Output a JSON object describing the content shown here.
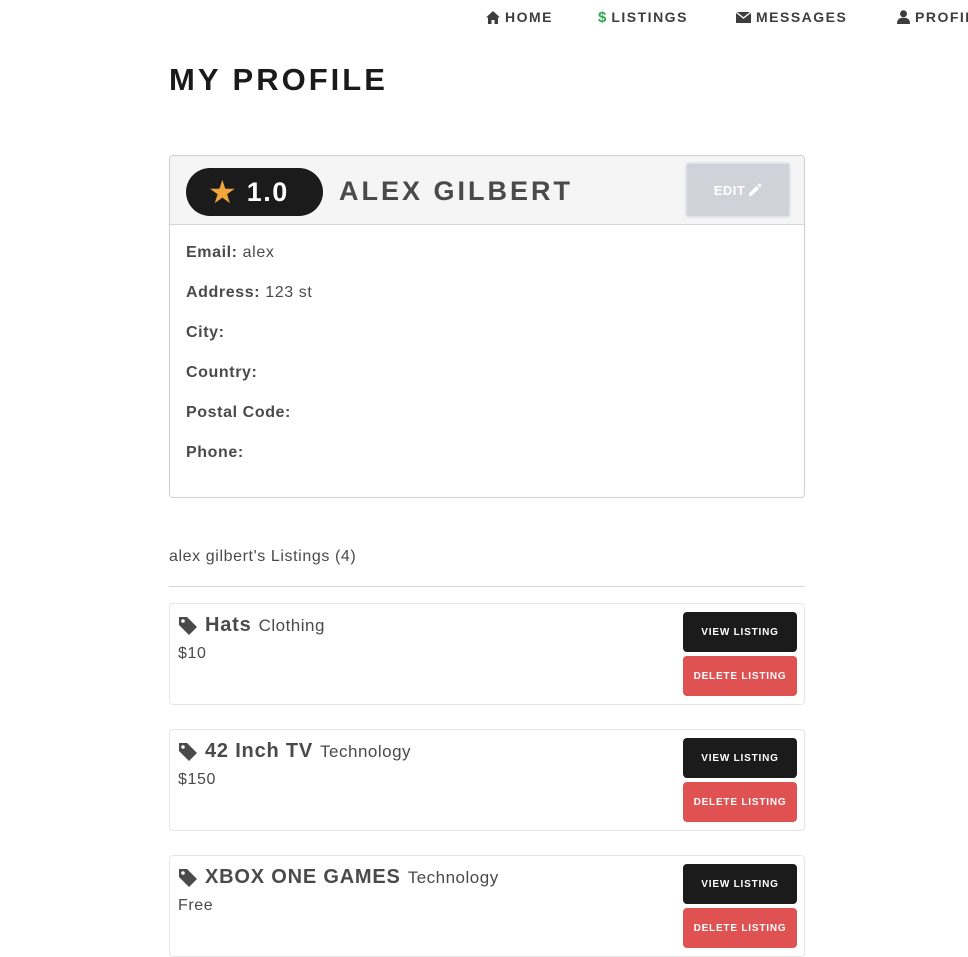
{
  "nav": {
    "items": [
      {
        "label": "HOME",
        "icon": "home-icon"
      },
      {
        "label": "LISTINGS",
        "icon": "dollar-icon"
      },
      {
        "label": "MESSAGES",
        "icon": "envelope-icon"
      },
      {
        "label": "PROFILE",
        "icon": "user-icon"
      }
    ],
    "listings_icon_glyph": "$",
    "listings_icon_color": "#2fa84f"
  },
  "page": {
    "title": "MY PROFILE"
  },
  "profile": {
    "rating": "1.0",
    "rating_icon": "star-icon",
    "star_color": "#f0a63a",
    "name": "ALEX GILBERT",
    "edit_label": "EDIT",
    "fields": [
      {
        "label": "Email:",
        "value": "alex"
      },
      {
        "label": "Address:",
        "value": "123 st"
      },
      {
        "label": "City:",
        "value": ""
      },
      {
        "label": "Country:",
        "value": ""
      },
      {
        "label": "Postal Code:",
        "value": ""
      },
      {
        "label": "Phone:",
        "value": ""
      }
    ]
  },
  "listings": {
    "heading": "alex gilbert's Listings (4)",
    "view_label": "VIEW LISTING",
    "delete_label": "DELETE LISTING",
    "delete_color": "#e05252",
    "items": [
      {
        "title": "Hats",
        "category": "Clothing",
        "price": "$10"
      },
      {
        "title": "42 Inch TV",
        "category": "Technology",
        "price": "$150"
      },
      {
        "title": "XBOX ONE GAMES",
        "category": "Technology",
        "price": "Free"
      }
    ]
  }
}
